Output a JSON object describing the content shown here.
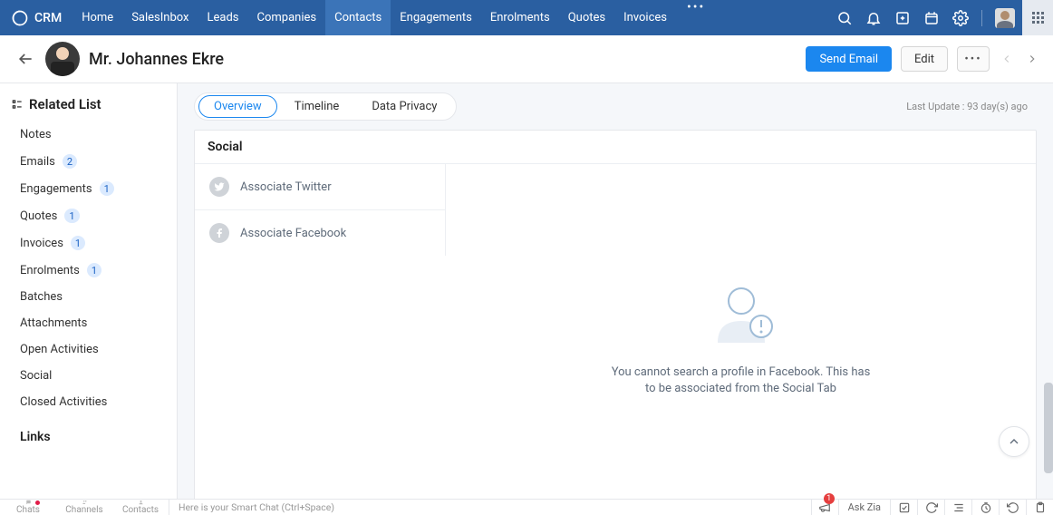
{
  "topnav": {
    "brand": "CRM",
    "items": [
      "Home",
      "SalesInbox",
      "Leads",
      "Companies",
      "Contacts",
      "Engagements",
      "Enrolments",
      "Quotes",
      "Invoices"
    ],
    "active_index": 4
  },
  "record": {
    "title": "Mr. Johannes Ekre",
    "send_email": "Send Email",
    "edit": "Edit"
  },
  "sidebar": {
    "heading": "Related List",
    "items": [
      {
        "label": "Notes"
      },
      {
        "label": "Emails",
        "badge": "2"
      },
      {
        "label": "Engagements",
        "badge": "1"
      },
      {
        "label": "Quotes",
        "badge": "1"
      },
      {
        "label": "Invoices",
        "badge": "1"
      },
      {
        "label": "Enrolments",
        "badge": "1"
      },
      {
        "label": "Batches"
      },
      {
        "label": "Attachments"
      },
      {
        "label": "Open Activities"
      },
      {
        "label": "Social"
      },
      {
        "label": "Closed Activities"
      }
    ],
    "links_heading": "Links"
  },
  "tabs": {
    "items": [
      "Overview",
      "Timeline",
      "Data Privacy"
    ],
    "active_index": 0,
    "last_update": "Last Update : 93 day(s) ago"
  },
  "panel": {
    "title": "Social",
    "assoc_twitter": "Associate Twitter",
    "assoc_facebook": "Associate Facebook",
    "empty_msg": "You cannot search a profile in Facebook. This has to be associated from the Social Tab"
  },
  "bottombar": {
    "tabs": [
      "Chats",
      "Channels",
      "Contacts"
    ],
    "smart_chat": "Here is your Smart Chat (Ctrl+Space)",
    "ask_zia": "Ask Zia",
    "megaphone_badge": "1"
  }
}
